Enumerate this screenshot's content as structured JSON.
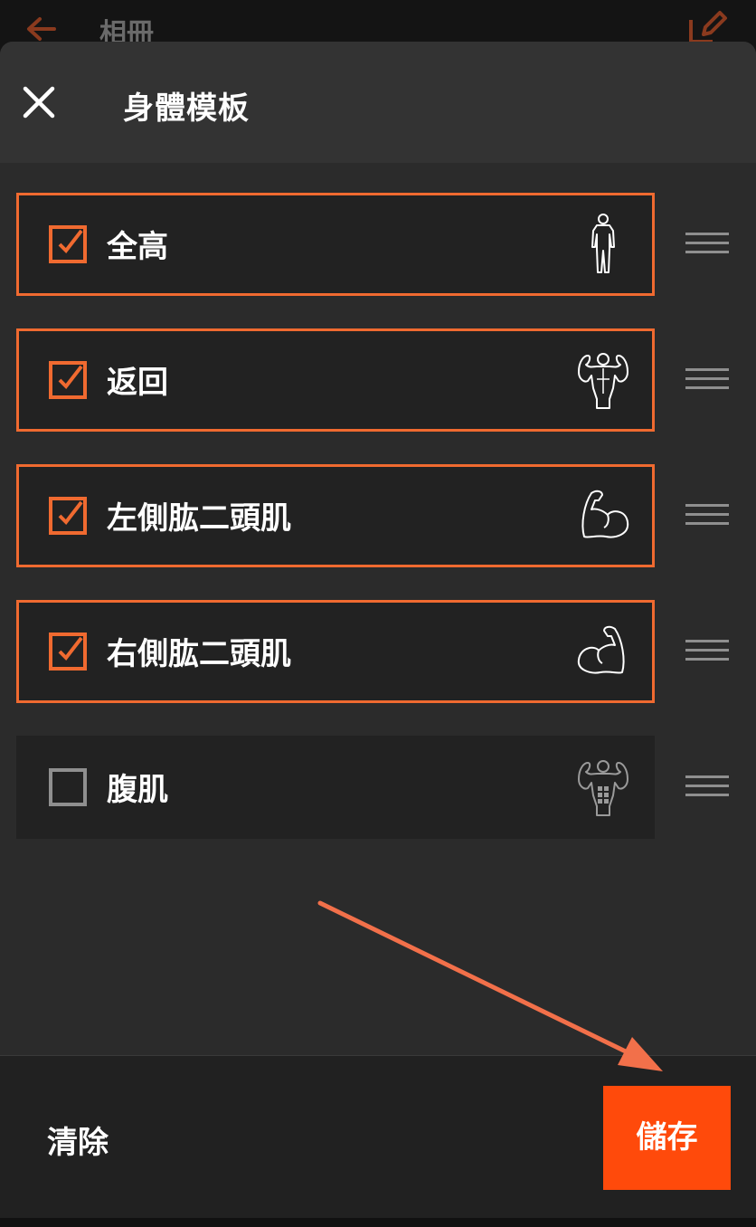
{
  "app_bar": {
    "title": "相冊",
    "back_icon": "arrow-left-icon",
    "edit_icon": "edit-icon"
  },
  "sheet": {
    "title": "身體模板",
    "close_icon": "close-icon"
  },
  "templates": [
    {
      "label": "全高",
      "checked": true,
      "icon": "full-body-icon"
    },
    {
      "label": "返回",
      "checked": true,
      "icon": "back-muscles-icon"
    },
    {
      "label": "左側肱二頭肌",
      "checked": true,
      "icon": "left-bicep-icon"
    },
    {
      "label": "右側肱二頭肌",
      "checked": true,
      "icon": "right-bicep-icon"
    },
    {
      "label": "腹肌",
      "checked": false,
      "icon": "abs-icon"
    }
  ],
  "footer": {
    "clear_label": "清除",
    "save_label": "儲存"
  },
  "colors": {
    "accent": "#f06a30",
    "save_button": "#ff4a0b",
    "annotation_arrow": "#f2704a"
  }
}
